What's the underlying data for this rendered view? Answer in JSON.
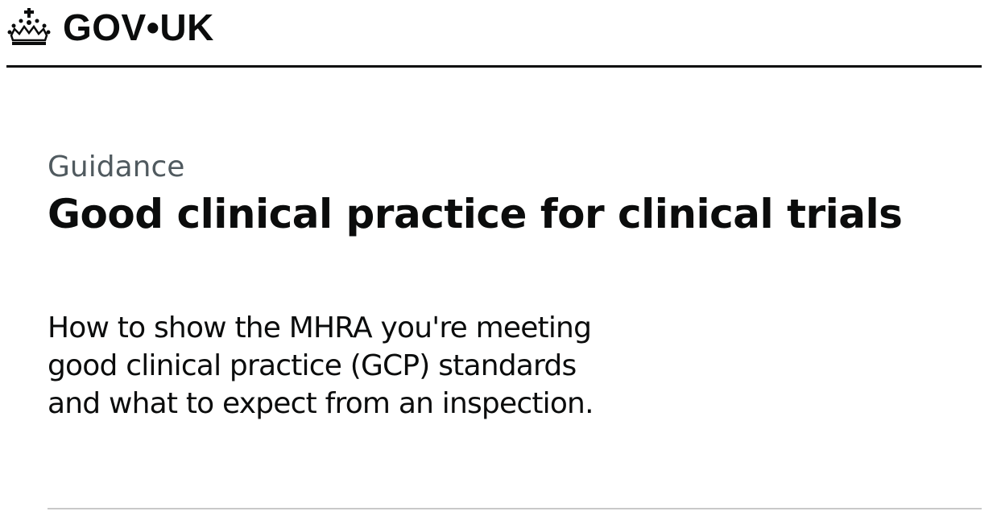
{
  "header": {
    "logo_text": "GOV•UK",
    "logo_icon": "crown-icon"
  },
  "page": {
    "caption": "Guidance",
    "title": "Good clinical practice for clinical trials",
    "lede": "How to show the MHRA you're meeting good clinical practice (GCP) standards and what to expect from an inspection."
  },
  "colors": {
    "text": "#0b0c0c",
    "caption": "#505a5f",
    "divider": "#c9c9c9"
  }
}
